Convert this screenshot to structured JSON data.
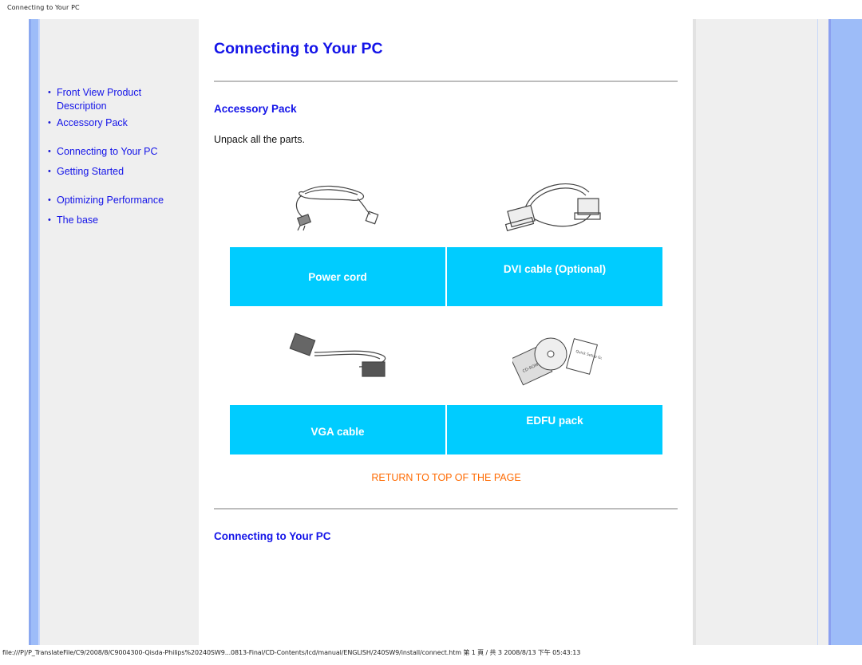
{
  "print_header": "Connecting to Your PC",
  "sidebar": {
    "items": [
      {
        "label": "Front View Product Description"
      },
      {
        "label": "Accessory Pack"
      },
      {
        "label": "Connecting to Your PC"
      },
      {
        "label": "Getting Started"
      },
      {
        "label": "Optimizing Performance"
      },
      {
        "label": "The base"
      }
    ]
  },
  "main": {
    "title": "Connecting to Your PC",
    "sections": [
      {
        "title": "Accessory Pack"
      },
      {
        "title": "Connecting to Your PC"
      }
    ],
    "intro": "Unpack all the parts.",
    "accessories": [
      {
        "label": "Power cord",
        "icon": "power-cord-image"
      },
      {
        "label": "DVI cable (Optional)",
        "icon": "dvi-cable-image"
      },
      {
        "label": "VGA cable",
        "icon": "vga-cable-image"
      },
      {
        "label": "EDFU pack",
        "icon": "edfu-pack-image"
      }
    ],
    "edfu_texts": {
      "cd": "CD-ROM",
      "guide": "Quick Setup Guide"
    },
    "return_link": "RETURN TO TOP OF THE PAGE"
  },
  "colors": {
    "link": "#1414e8",
    "label_bg": "#00ccff",
    "return_link": "#ff6a00",
    "frame_stripe": "#9dbcf8"
  },
  "print_footer": "file:///P|/P_TranslateFile/C9/2008/8/C9004300-Qisda-Philips%20240SW9...0813-Final/CD-Contents/lcd/manual/ENGLISH/240SW9/install/connect.htm 第 1 頁 / 共 3 2008/8/13 下午 05:43:13"
}
